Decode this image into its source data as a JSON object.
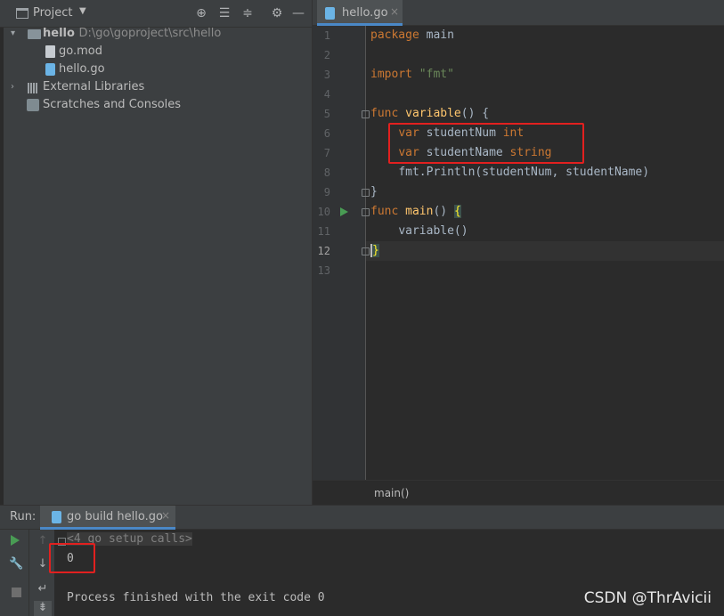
{
  "project_panel": {
    "title": "Project",
    "header_icons": [
      "locate-icon",
      "expand-all-icon",
      "collapse-all-icon",
      "settings-icon",
      "hide-icon"
    ],
    "tree": [
      {
        "label": "hello",
        "path": "D:\\go\\goproject\\src\\hello",
        "type": "folder",
        "expanded": true
      },
      {
        "label": "go.mod",
        "type": "file"
      },
      {
        "label": "hello.go",
        "type": "go-file"
      },
      {
        "label": "External Libraries",
        "type": "libraries",
        "expanded": false
      },
      {
        "label": "Scratches and Consoles",
        "type": "scratches"
      }
    ]
  },
  "editor": {
    "tab_label": "hello.go",
    "tab_close": "×",
    "current_line": 12,
    "line_numbers": [
      "1",
      "2",
      "3",
      "4",
      "5",
      "6",
      "7",
      "8",
      "9",
      "10",
      "11",
      "12",
      "13"
    ],
    "lines": [
      {
        "kw": "package",
        "rest": " main"
      },
      {},
      {
        "kw": "import",
        "str": " \"fmt\""
      },
      {},
      {
        "kw": "func",
        "fn": " variable",
        "rest": "() {"
      },
      {
        "indent": "    ",
        "kw": "var",
        "rest": " studentNum ",
        "ty": "int"
      },
      {
        "indent": "    ",
        "kw": "var",
        "rest": " studentName ",
        "ty": "string"
      },
      {
        "indent": "    ",
        "rest": "fmt.Println(studentNum, studentName)"
      },
      {
        "rest": "}"
      },
      {
        "kw": "func",
        "fn": " main",
        "rest": "() ",
        "brace": "{"
      },
      {
        "indent": "    ",
        "rest": "variable()"
      },
      {
        "brace": "}"
      },
      {}
    ],
    "breadcrumb": "main()"
  },
  "run_panel": {
    "label": "Run:",
    "tab_label": "go build hello.go",
    "tab_close": "×",
    "console": {
      "setup_line": "<4 go setup calls>",
      "output_line": "0",
      "exit_line": "Process finished with the exit code 0"
    }
  },
  "watermark": "CSDN @ThrAvicii",
  "colors": {
    "accent": "#4a88c7",
    "keyword": "#cc7832",
    "function": "#ffc66d",
    "string": "#6a8759",
    "highlight_box": "#e2201f",
    "run_green": "#499c54"
  }
}
